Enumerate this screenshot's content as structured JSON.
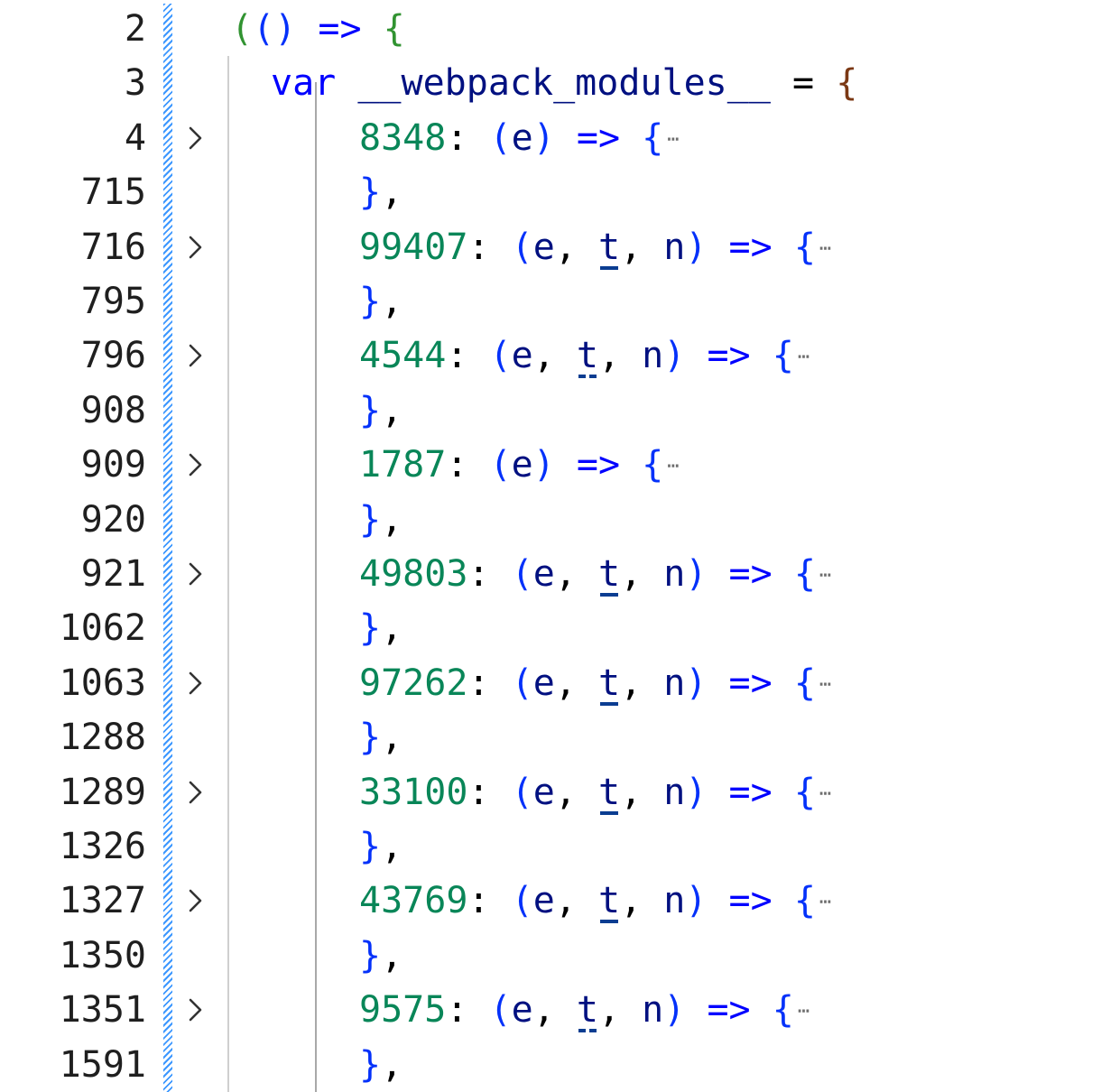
{
  "editor": {
    "line_numbers": [
      "2",
      "3",
      "4",
      "715",
      "716",
      "795",
      "796",
      "908",
      "909",
      "920",
      "921",
      "1062",
      "1063",
      "1288",
      "1289",
      "1326",
      "1327",
      "1350",
      "1351",
      "1591"
    ],
    "folded_marker": "⋯",
    "header": {
      "iife_open_paren": "(",
      "iife_arrow_params": "()",
      "arrow": "=>",
      "open_brace": "{",
      "var_keyword": "var",
      "var_name": "__webpack_modules__",
      "assign": "=",
      "object_open": "{"
    },
    "modules": [
      {
        "id": "8348",
        "params": [
          "e"
        ],
        "underline": ""
      },
      {
        "id": "99407",
        "params": [
          "e",
          "t",
          "n"
        ],
        "underline": "solid"
      },
      {
        "id": "4544",
        "params": [
          "e",
          "t",
          "n"
        ],
        "underline": "dashed"
      },
      {
        "id": "1787",
        "params": [
          "e"
        ],
        "underline": ""
      },
      {
        "id": "49803",
        "params": [
          "e",
          "t",
          "n"
        ],
        "underline": "solid"
      },
      {
        "id": "97262",
        "params": [
          "e",
          "t",
          "n"
        ],
        "underline": "solid"
      },
      {
        "id": "33100",
        "params": [
          "e",
          "t",
          "n"
        ],
        "underline": "solid"
      },
      {
        "id": "43769",
        "params": [
          "e",
          "t",
          "n"
        ],
        "underline": "solid"
      },
      {
        "id": "9575",
        "params": [
          "e",
          "t",
          "n"
        ],
        "underline": "dashed"
      }
    ],
    "close_brace": "},",
    "colors": {
      "number": "#098658",
      "keyword": "#0000ff",
      "variable": "#001080",
      "bracket_level1": "#319331",
      "bracket_level2": "#0431fa",
      "bracket_level3": "#7b3814",
      "diff_bar": "#1a85ff"
    },
    "icons": {
      "fold": "chevron-right-icon"
    }
  }
}
